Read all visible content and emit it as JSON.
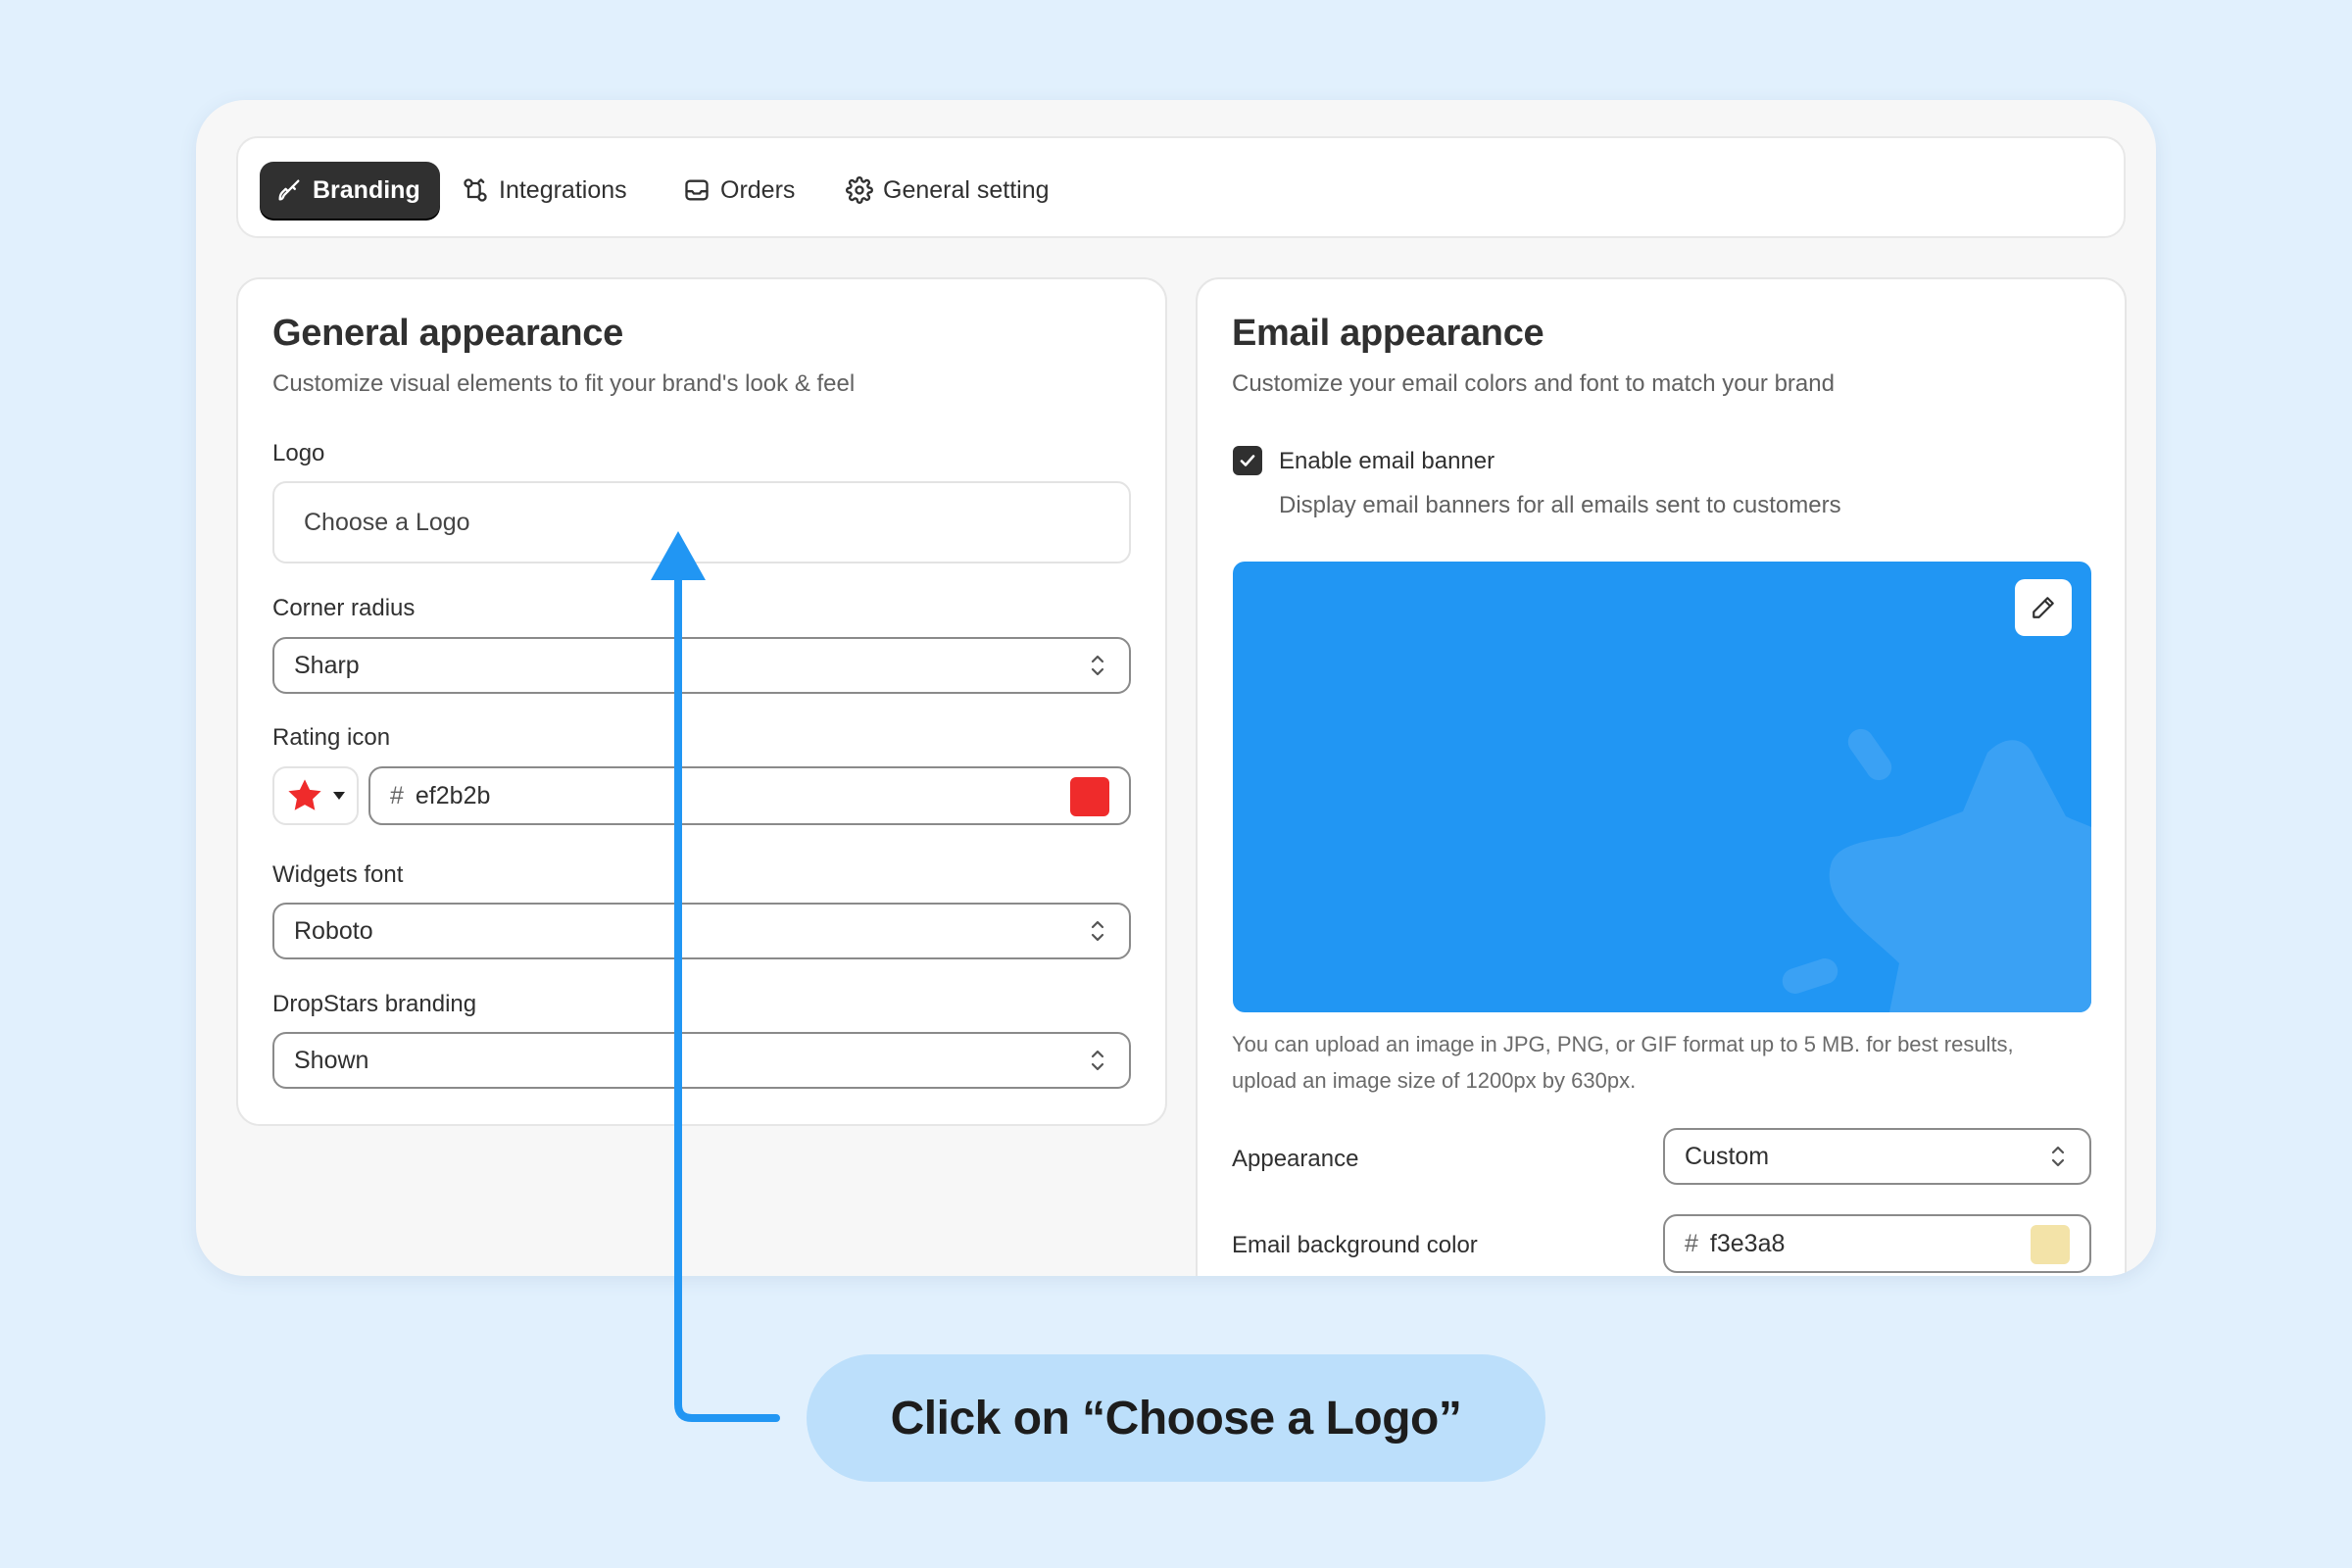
{
  "tabs": [
    {
      "label": "Branding",
      "icon": "paintbrush-icon",
      "active": true
    },
    {
      "label": "Integrations",
      "icon": "integrations-icon",
      "active": false
    },
    {
      "label": "Orders",
      "icon": "inbox-icon",
      "active": false
    },
    {
      "label": "General setting",
      "icon": "gear-icon",
      "active": false
    }
  ],
  "general": {
    "title": "General appearance",
    "subtitle": "Customize visual elements to fit your brand's look & feel",
    "logo_label": "Logo",
    "logo_placeholder": "Choose a Logo",
    "corner_label": "Corner radius",
    "corner_value": "Sharp",
    "rating_label": "Rating icon",
    "rating_hash": "#",
    "rating_color": "ef2b2b",
    "rating_swatch": "#ef2b2b",
    "font_label": "Widgets font",
    "font_value": "Roboto",
    "branding_label": "DropStars branding",
    "branding_value": "Shown"
  },
  "email": {
    "title": "Email appearance",
    "subtitle": "Customize your email colors and font to match your brand",
    "banner_checkbox_label": "Enable email banner",
    "banner_checked": true,
    "banner_help": "Display email banners for all emails sent to customers",
    "banner_color": "#2196f3",
    "upload_help_1": "You can upload an image in JPG, PNG, or GIF format up to 5 MB. for best results,",
    "upload_help_2": "upload an image size of 1200px by 630px.",
    "appearance_label": "Appearance",
    "appearance_value": "Custom",
    "bg_label": "Email background color",
    "bg_hash": "#",
    "bg_color": "f3e3a8",
    "bg_swatch": "#f3e3a8"
  },
  "callout": {
    "text": "Click on “Choose a Logo”"
  },
  "colors": {
    "page_bg": "#e1f0fd",
    "arrow": "#2196f3",
    "callout_bg": "#bcdffb"
  }
}
